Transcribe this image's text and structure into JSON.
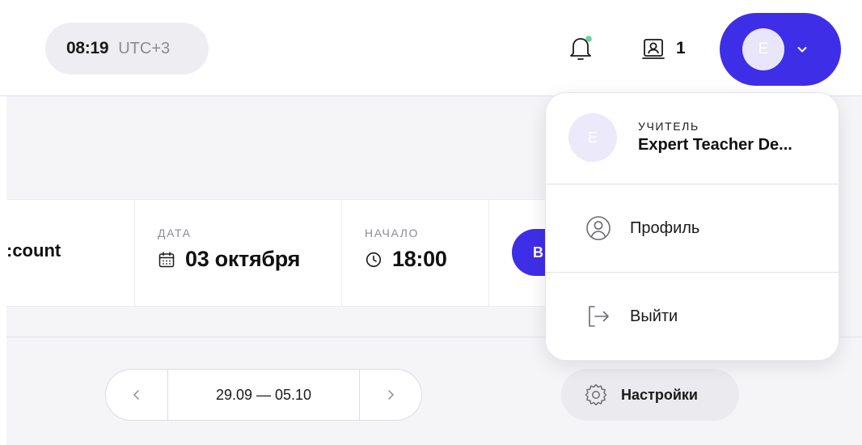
{
  "header": {
    "time": "08:19",
    "timezone": "UTC+3",
    "students_count": "1",
    "user_initial": "E"
  },
  "lesson": {
    "title": ":count",
    "date_label": "ДАТА",
    "date_value": "03 октября",
    "start_label": "НАЧАЛО",
    "start_value": "18:00",
    "action_label": "В"
  },
  "week_nav": {
    "range": "29.09 — 05.10"
  },
  "settings": {
    "label": "Настройки"
  },
  "user_menu": {
    "role": "УЧИТЕЛЬ",
    "name": "Expert Teacher De...",
    "initial": "E",
    "items": [
      {
        "label": "Профиль",
        "icon": "profile-icon"
      },
      {
        "label": "Выйти",
        "icon": "logout-icon"
      }
    ]
  },
  "colors": {
    "accent": "#3f2ee8",
    "notification_dot": "#6ad39b"
  }
}
